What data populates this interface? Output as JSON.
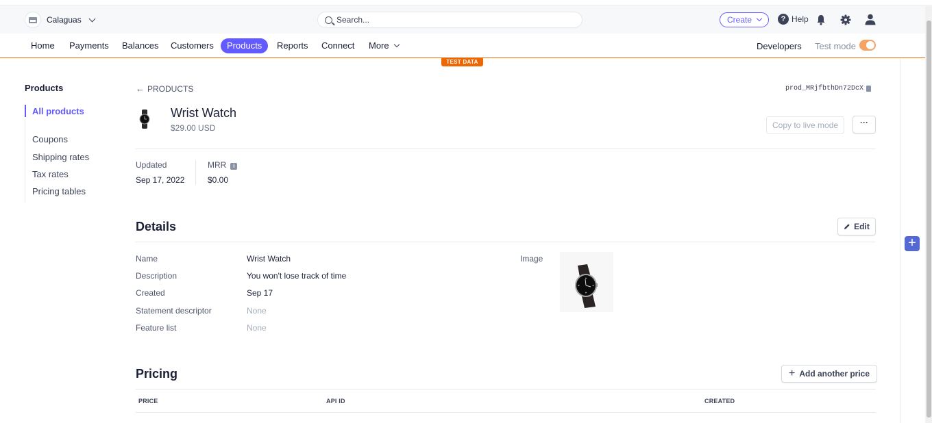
{
  "account": {
    "name": "Calaguas"
  },
  "search": {
    "placeholder": "Search..."
  },
  "topbar": {
    "create_label": "Create",
    "help_label": "Help"
  },
  "nav": {
    "items": [
      "Home",
      "Payments",
      "Balances",
      "Customers",
      "Products",
      "Reports",
      "Connect",
      "More"
    ],
    "active": "Products",
    "developers_label": "Developers",
    "test_mode_label": "Test mode"
  },
  "test_data_badge": "TEST DATA",
  "sidebar": {
    "title": "Products",
    "items": [
      {
        "label": "All products",
        "active": true
      },
      {
        "label": "Coupons"
      },
      {
        "label": "Shipping rates"
      },
      {
        "label": "Tax rates"
      },
      {
        "label": "Pricing tables"
      }
    ]
  },
  "product": {
    "back_label": "PRODUCTS",
    "id": "prod_MRjfbthDn72DcX",
    "name": "Wrist Watch",
    "price": "$29.00 USD",
    "copy_live_label": "Copy to live mode",
    "more_label": "···",
    "updated_label": "Updated",
    "updated_value": "Sep 17, 2022",
    "mrr_label": "MRR",
    "mrr_value": "$0.00"
  },
  "details": {
    "title": "Details",
    "edit_label": "Edit",
    "rows": [
      {
        "label": "Name",
        "value": "Wrist Watch"
      },
      {
        "label": "Description",
        "value": "You won't lose track of time"
      },
      {
        "label": "Created",
        "value": "Sep 17"
      },
      {
        "label": "Statement descriptor",
        "value": "None"
      },
      {
        "label": "Feature list",
        "value": "None"
      }
    ],
    "image_label": "Image"
  },
  "pricing": {
    "title": "Pricing",
    "add_label": "Add another price",
    "columns": [
      "PRICE",
      "API ID",
      "CREATED"
    ]
  },
  "colors": {
    "accent": "#635bff",
    "test_orange": "#ed6704"
  }
}
